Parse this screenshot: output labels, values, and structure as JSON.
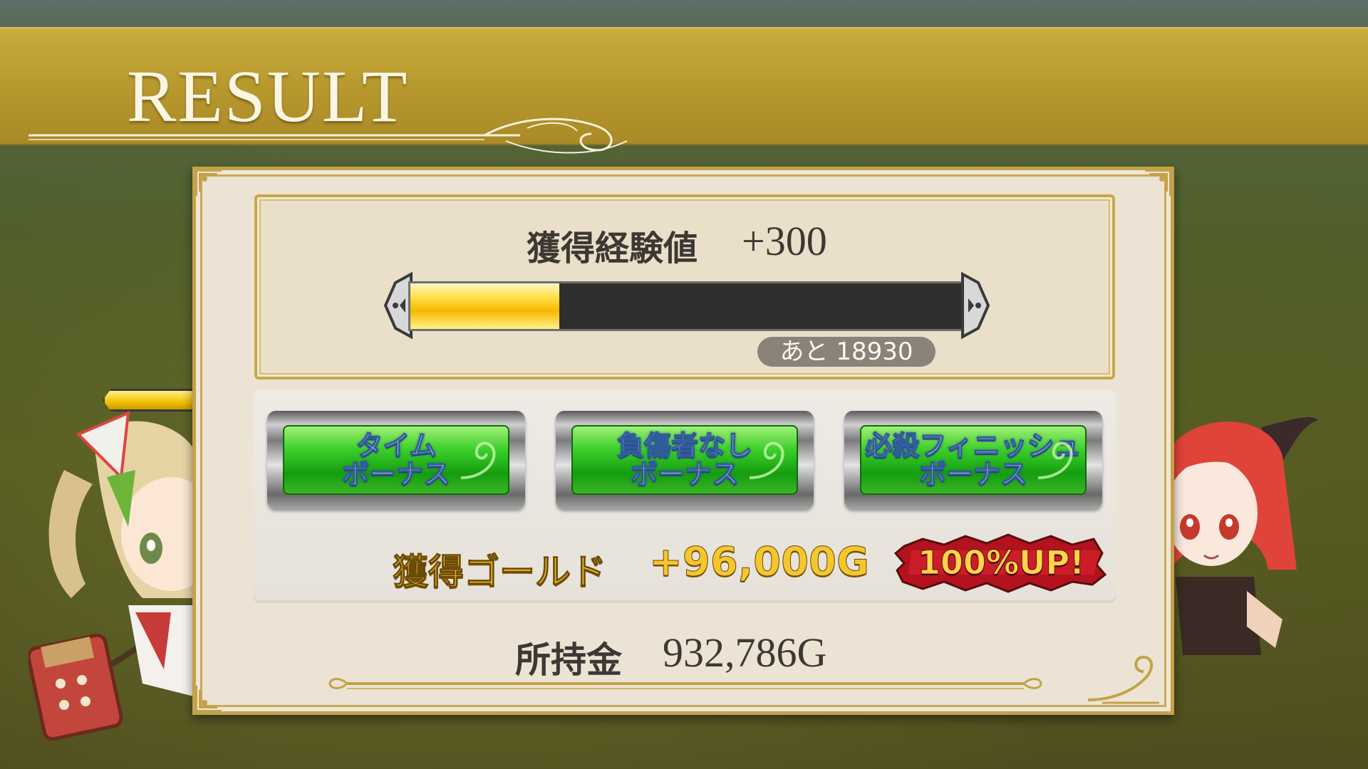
{
  "header": {
    "title": "RESULT"
  },
  "experience": {
    "label": "獲得経験値",
    "value": "+300",
    "remaining": "あと 18930",
    "progress_fraction": 0.27
  },
  "bonuses": [
    {
      "label": "タイム\nボーナス"
    },
    {
      "label": "負傷者なし\nボーナス"
    },
    {
      "label": "必殺フィニッシュ\nボーナス"
    }
  ],
  "gold": {
    "label": "獲得ゴールド",
    "value": "+96,000G",
    "badge": "100%UP!"
  },
  "money": {
    "label": "所持金",
    "value": "932,786G"
  },
  "colors": {
    "header_gold": "#b8992e",
    "panel_bg": "#ede3d4",
    "bonus_green": "#3ccf2a",
    "gold_text": "#f3c229",
    "badge_red": "#b3121f"
  },
  "icons": {
    "header_flourish": "flourish-ornament",
    "corners": "ornate-corner",
    "bar_caps": "fleur-de-lis-cap",
    "bonus_swirl": "swirl-ornament"
  }
}
